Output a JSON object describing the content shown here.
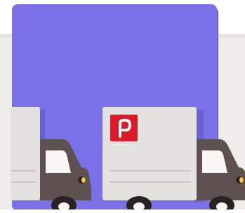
{
  "illustration": {
    "subject": "delivery-trucks",
    "icons": [
      "post-logo-icon"
    ],
    "colors": {
      "panel_back": "#EEEDEA",
      "card": "#7A70E8",
      "card_shadow": "#6960D2",
      "box": "#E4E2DF",
      "box_shade": "#C9C6C1",
      "cab": "#5E514F",
      "cab_light": "#766864",
      "window": "#F7F6F4",
      "wheel": "#2A2220",
      "logo_red": "#DC1928",
      "headlight": "#F4C542"
    }
  }
}
